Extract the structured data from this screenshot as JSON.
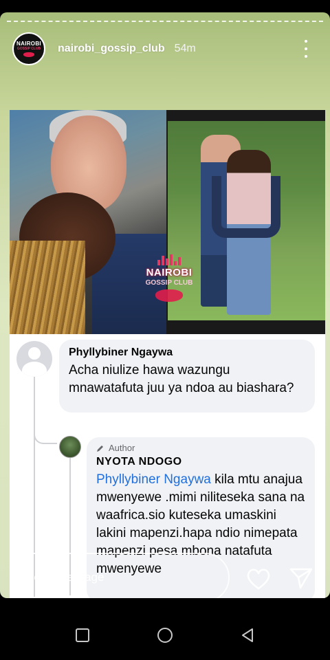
{
  "story": {
    "username": "nairobi_gossip_club",
    "time": "54m",
    "avatar_logo": {
      "line1": "NAIROBI",
      "line2": "GOSSIP CLUB"
    }
  },
  "image": {
    "watermark_line1": "NAIROBI",
    "watermark_line2": "GOSSIP CLUB"
  },
  "comments": [
    {
      "name": "Phyllybiner Ngaywa",
      "text": "Acha niulize hawa wazungu mnawatafuta juu ya ndoa au biashara?"
    }
  ],
  "reply": {
    "badge": "Author",
    "name": "NYOTA  NDOGO",
    "mention": "Phyllybiner Ngaywa",
    "text": " kila mtu anajua mwenyewe .mimi niliteseka sana na waafrica.sio kuteseka umaskini lakini mapenzi.hapa ndio nimepata mapenzi pesa mbona natafuta mwenyewe"
  },
  "footer": {
    "send_placeholder": "Send message"
  },
  "colors": {
    "mention": "#216fdb",
    "bubble": "#f0f2f5",
    "brand_pink": "#e01e4b"
  }
}
